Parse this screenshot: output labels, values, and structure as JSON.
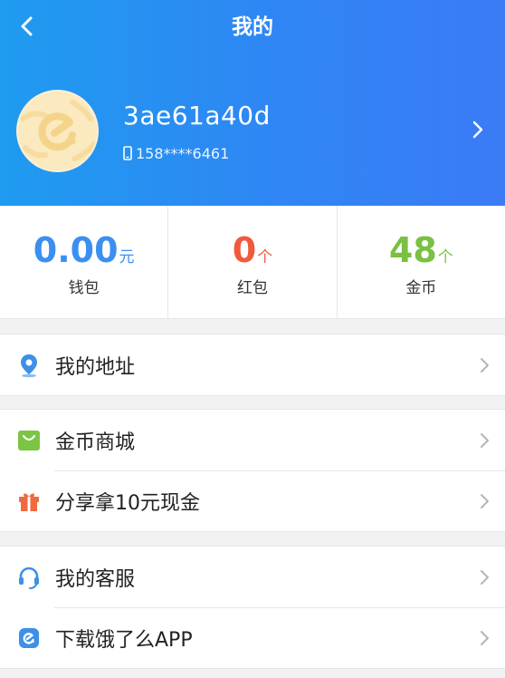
{
  "header": {
    "title": "我的",
    "username": "3ae61a40d",
    "phone": "158****6461",
    "background": "#2a8ff2"
  },
  "stats": [
    {
      "value": "0.00",
      "unit": "元",
      "label": "钱包",
      "color": "#3b8ff0"
    },
    {
      "value": "0",
      "unit": "个",
      "label": "红包",
      "color": "#f05a3c"
    },
    {
      "value": "48",
      "unit": "个",
      "label": "金币",
      "color": "#7ac043"
    }
  ],
  "menu": {
    "address": {
      "label": "我的地址",
      "icon": "location-pin-icon"
    },
    "mall": {
      "label": "金币商城",
      "icon": "shopping-bag-icon"
    },
    "share": {
      "label": "分享拿10元现金",
      "icon": "gift-icon"
    },
    "service": {
      "label": "我的客服",
      "icon": "headset-icon"
    },
    "download": {
      "label": "下载饿了么APP",
      "icon": "eleme-logo-icon"
    }
  }
}
